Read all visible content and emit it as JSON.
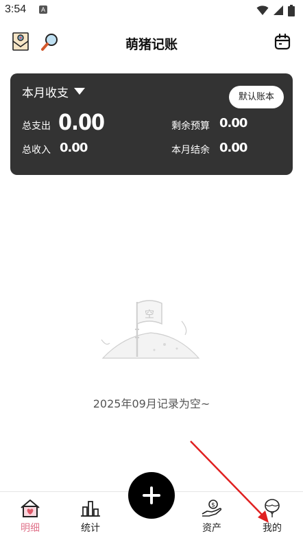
{
  "status": {
    "time": "3:54",
    "indicator": "A"
  },
  "app": {
    "title": "萌猪记账"
  },
  "summary": {
    "period": "本月收支",
    "ledger_button": "默认账本",
    "total_expense_label": "总支出",
    "total_expense_value": "0.00",
    "total_income_label": "总收入",
    "total_income_value": "0.00",
    "budget_left_label": "剩余预算",
    "budget_left_value": "0.00",
    "balance_label": "本月结余",
    "balance_value": "0.00"
  },
  "empty": {
    "flag_char": "空",
    "message": "2025年09月记录为空~"
  },
  "tabs": [
    {
      "label": "明细",
      "icon": "house-heart-icon",
      "active": true
    },
    {
      "label": "统计",
      "icon": "bar-chart-icon",
      "active": false
    },
    {
      "label": "资产",
      "icon": "hand-coin-icon",
      "active": false
    },
    {
      "label": "我的",
      "icon": "balloon-icon",
      "active": false
    }
  ],
  "colors": {
    "card_bg": "#333333",
    "accent": "#e0738b",
    "annotation_arrow": "#e02020"
  }
}
